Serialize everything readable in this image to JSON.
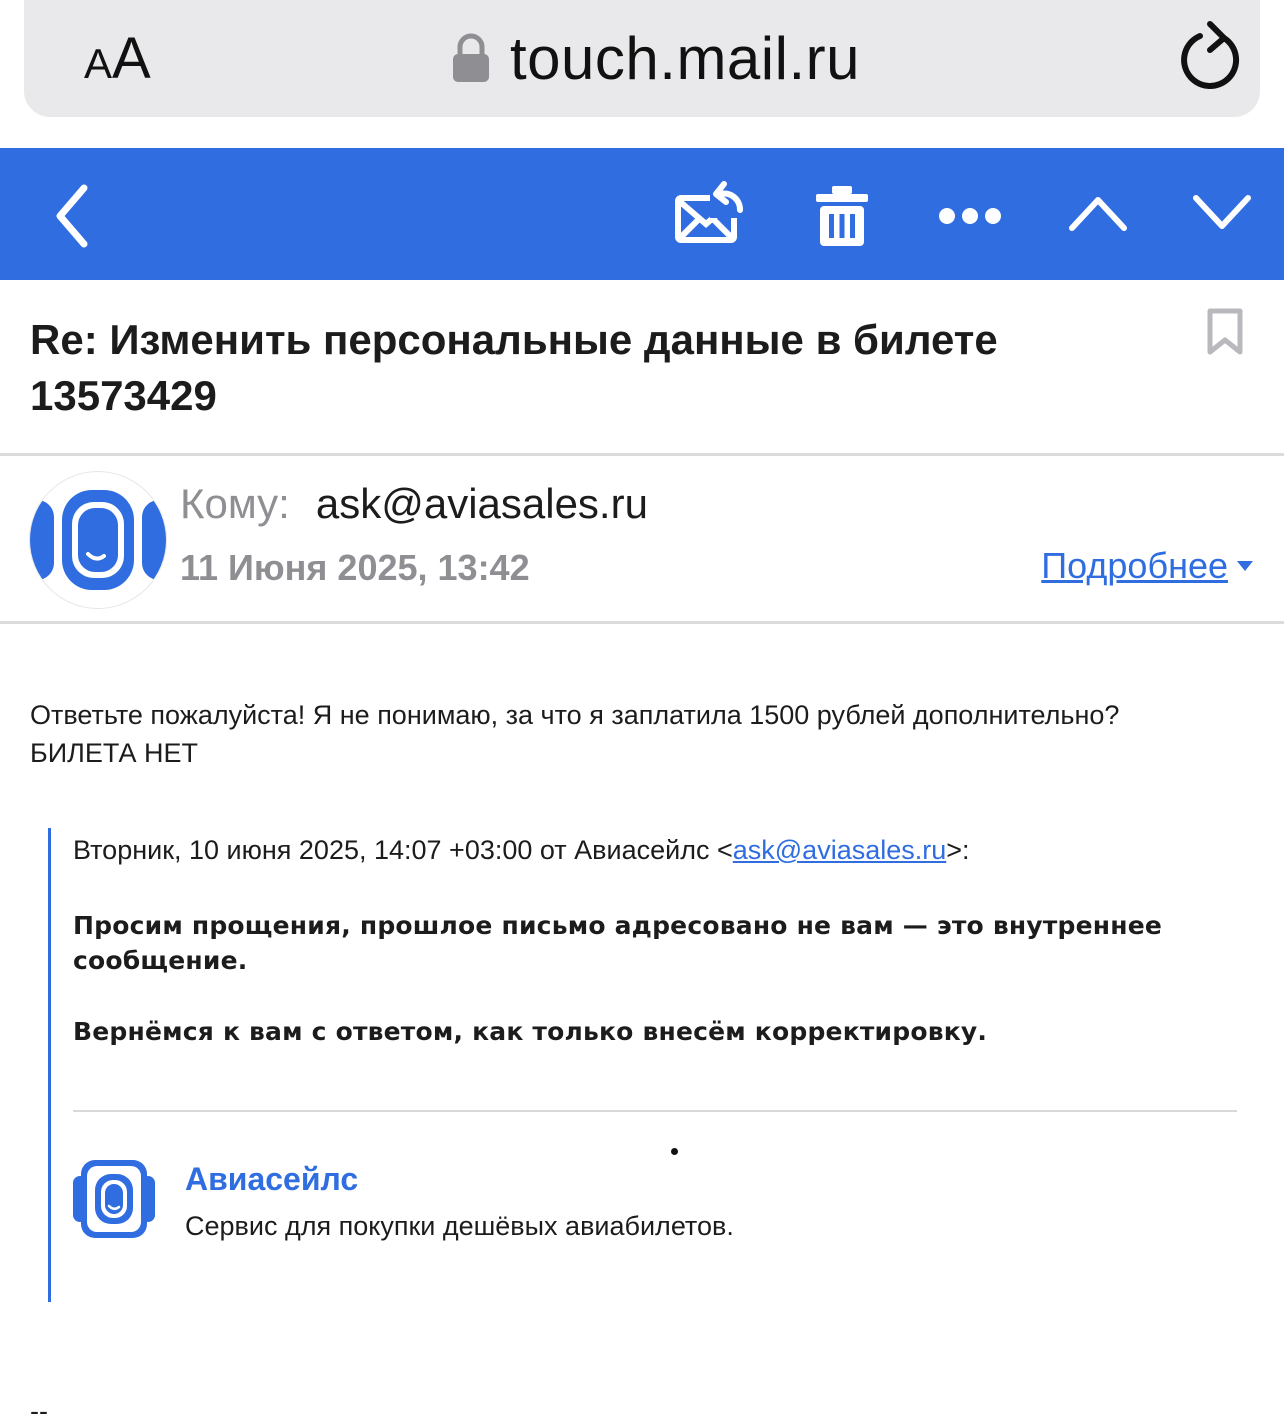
{
  "browser": {
    "text_size_small": "A",
    "text_size_big": "A",
    "url": "touch.mail.ru",
    "lock_icon": "lock-icon",
    "reload_icon": "reload-icon"
  },
  "toolbar": {
    "background": "#2f6de1",
    "icons": [
      "back-chevron-icon",
      "move-mail-icon",
      "trash-icon",
      "more-dots-icon",
      "chevron-up-icon",
      "chevron-down-icon"
    ]
  },
  "message": {
    "subject": "Re: Изменить персональные данные в билете 13573429",
    "to_label": "Кому:",
    "to_address": "ask@aviasales.ru",
    "date": "11 Июня 2025, 13:42",
    "details_label": "Подробнее",
    "body_line1": "Ответьте пожалуйста! Я не понимаю, за что я заплатила 1500 рублей дополнительно?",
    "body_line2": "БИЛЕТА НЕТ"
  },
  "quote": {
    "header_prefix": "Вторник, 10 июня 2025, 14:07 +03:00 от Авиасейлс <",
    "header_email": "ask@aviasales.ru",
    "header_suffix": ">:",
    "para1": "Просим прощения, прошлое письмо адресовано не вам — это внутреннее сообщение.",
    "para2": "Вернёмся к вам с ответом, как только внесём корректировку."
  },
  "signature": {
    "company": "Авиасейлс",
    "description": "Сервис для покупки дешёвых авиабилетов.",
    "dashes": "--"
  },
  "colors": {
    "accent": "#2f6de1",
    "muted": "#8e8e93",
    "url_bar": "#e9e9eb"
  }
}
